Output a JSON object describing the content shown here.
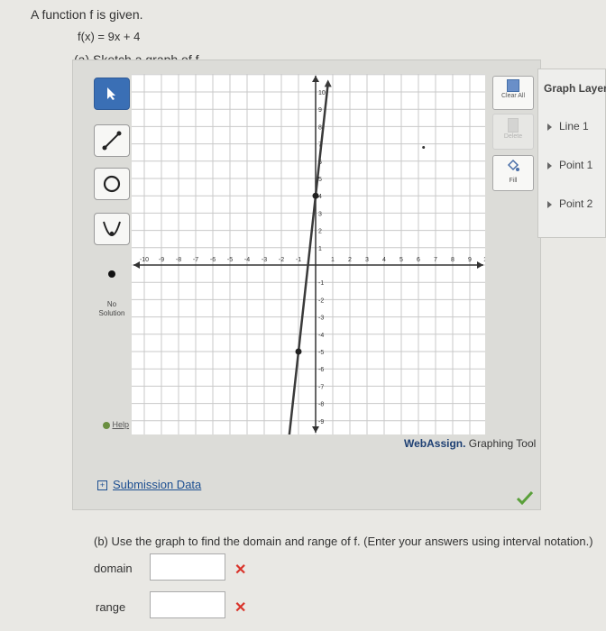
{
  "question": {
    "intro": "A function f is given.",
    "function_text": "f(x) = 9x + 4",
    "part_a": "(a) Sketch a graph of f.",
    "part_b": "(b) Use the graph to find the domain and range of f. (Enter your answers using interval notation.)"
  },
  "tools": {
    "no_solution": [
      "No",
      "Solution"
    ],
    "help": "Help"
  },
  "right_tools": {
    "clear_all": "Clear All",
    "delete": "Delete",
    "fill": "Fill"
  },
  "graph": {
    "x_ticks": [
      "-10",
      "-9",
      "-8",
      "-7",
      "-6",
      "-5",
      "-4",
      "-3",
      "-2",
      "-1",
      "1",
      "2",
      "3",
      "4",
      "5",
      "6",
      "7",
      "8",
      "9",
      "10"
    ],
    "y_ticks": [
      "10",
      "9",
      "8",
      "7",
      "6",
      "5",
      "4",
      "3",
      "2",
      "1",
      "-1",
      "-2",
      "-3",
      "-4",
      "-5",
      "-6",
      "-7",
      "-8",
      "-9",
      "-10"
    ],
    "line_slope": 9,
    "line_intercept": 4,
    "points": [
      [
        0,
        4
      ],
      [
        -1,
        -5
      ]
    ],
    "colors": {
      "line": "#3a3a3a",
      "grid": "#c9c9c9",
      "axis": "#333333"
    }
  },
  "brand": {
    "name": "WebAssign.",
    "suffix": " Graphing Tool"
  },
  "layers": {
    "title": "Graph Layers",
    "items": [
      "Line 1",
      "Point 1",
      "Point 2"
    ]
  },
  "submission_label": "Submission Data",
  "domain_label": "domain",
  "range_label": "range",
  "domain_value": "",
  "range_value": ""
}
